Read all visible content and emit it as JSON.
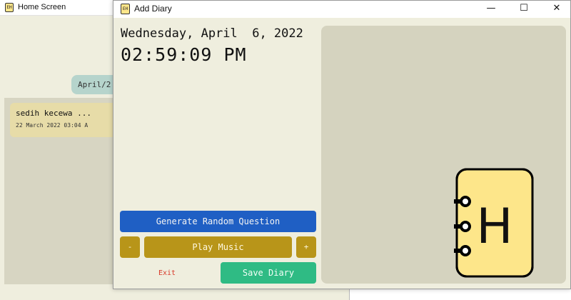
{
  "background_window": {
    "title": "Home Screen",
    "app_icon_text": "EH",
    "date_pill": "April/2",
    "entry": {
      "title": "sedih kecewa ...",
      "date": "22 March 2022  03:04 A"
    }
  },
  "window": {
    "title": "Add Diary",
    "app_icon_text": "EH",
    "controls": {
      "minimize": "—",
      "maximize": "☐",
      "close": "✕"
    }
  },
  "datetime": {
    "date": "Wednesday, April  6, 2022",
    "time": "02:59:09 PM"
  },
  "buttons": {
    "generate": "Generate Random Question",
    "volume_down": "-",
    "play_music": "Play Music",
    "volume_up": "+",
    "exit": "Exit",
    "save": "Save Diary"
  },
  "logo": {
    "letter": "H"
  },
  "colors": {
    "window_bg": "#efeede",
    "editor_bg": "#d5d3bf",
    "generate_button": "#1f5fc4",
    "music_buttons": "#b89519",
    "save_button": "#2fbb84",
    "exit_text": "#d83a2a",
    "logo_fill": "#fde68a"
  },
  "icons": [
    "app-icon",
    "notebook-logo-icon",
    "minimize-icon",
    "maximize-icon",
    "close-icon"
  ]
}
